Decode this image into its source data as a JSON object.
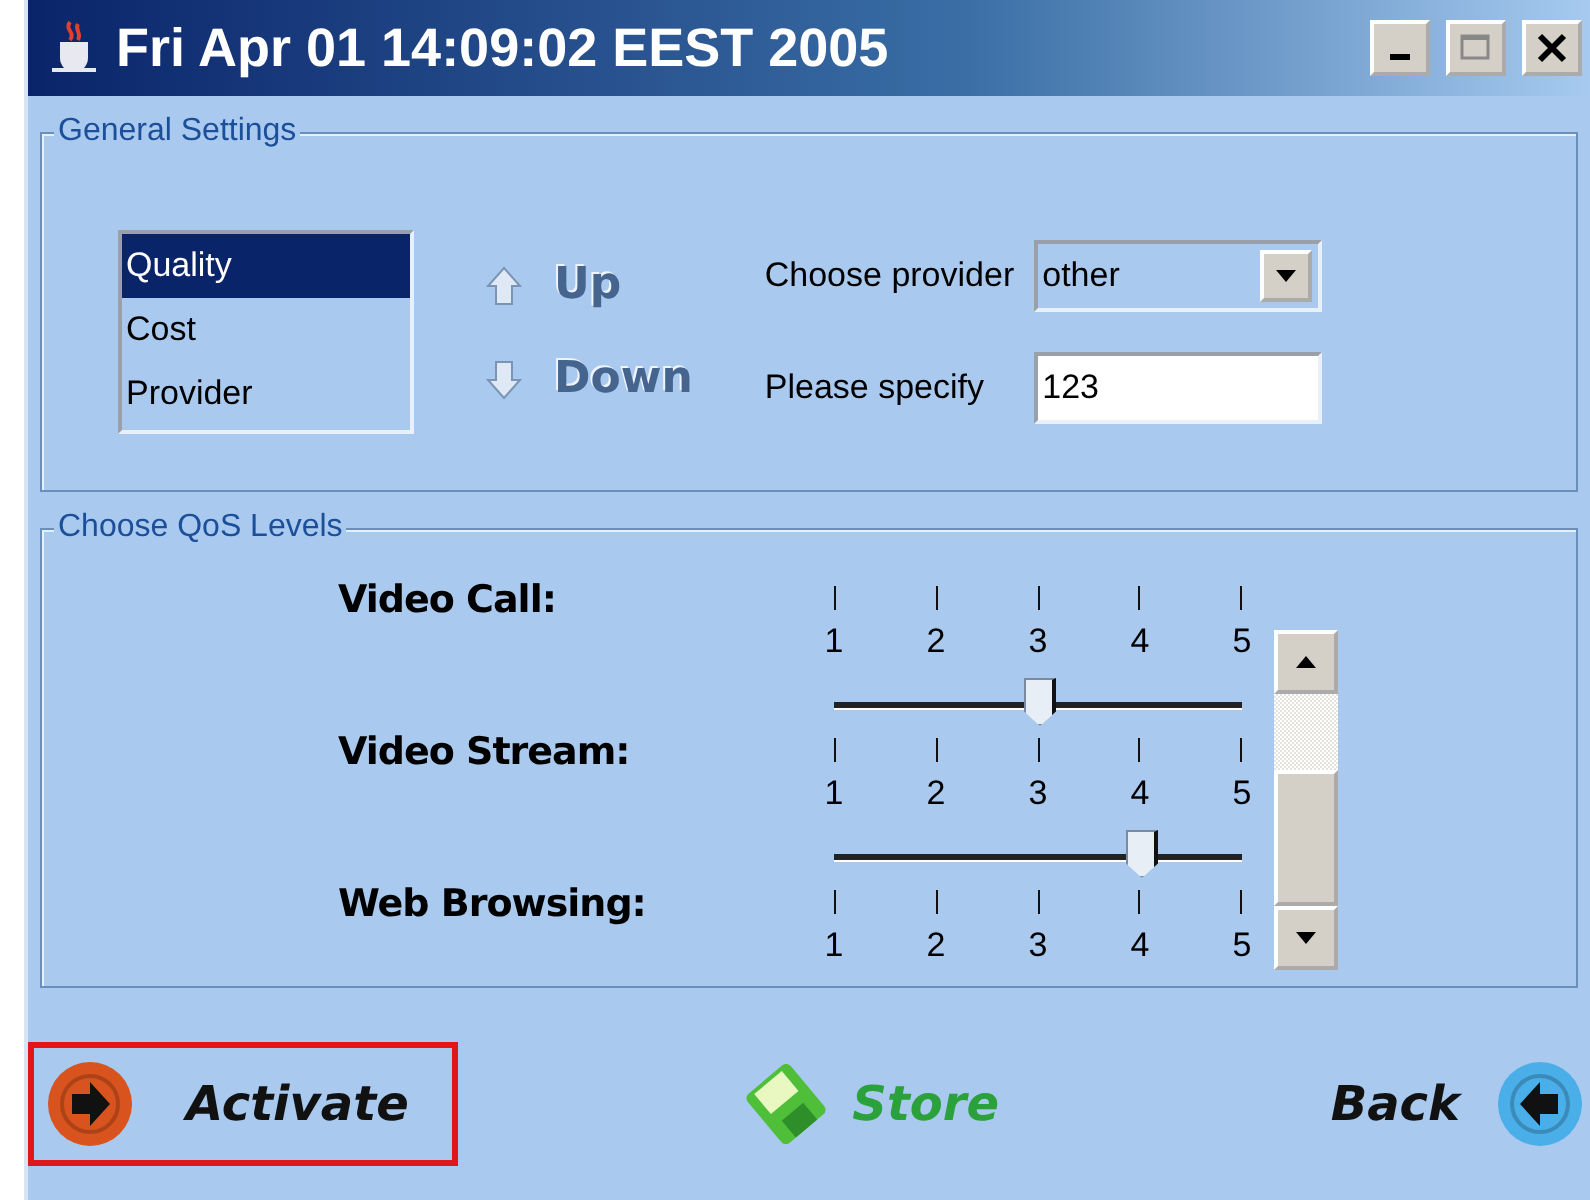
{
  "window": {
    "title": "Fri Apr 01 14:09:02 EEST 2005"
  },
  "general_settings": {
    "title": "General Settings",
    "criteria": [
      {
        "label": "Quality",
        "selected": true
      },
      {
        "label": "Cost",
        "selected": false
      },
      {
        "label": "Provider",
        "selected": false
      }
    ],
    "up_button": {
      "label": "Up",
      "disabled": true
    },
    "down_button": {
      "label": "Down",
      "disabled": true
    },
    "provider": {
      "label": "Choose provider",
      "value": "other"
    },
    "specify": {
      "label": "Please specify",
      "value": "123"
    }
  },
  "qos": {
    "title": "Choose QoS Levels",
    "sliders": [
      {
        "label": "Video Call:",
        "ticks": [
          "1",
          "2",
          "3",
          "4",
          "5"
        ]
      },
      {
        "label": "Video Stream:",
        "level": 0.5,
        "ticks": [
          "1",
          "2",
          "3",
          "4",
          "5"
        ]
      },
      {
        "label": "Web Browsing:",
        "level": 0.75,
        "ticks": [
          "1",
          "2",
          "3",
          "4",
          "5"
        ]
      }
    ]
  },
  "actions": [
    {
      "label": "Activate",
      "kind": "activate",
      "focused": true
    },
    {
      "label": "Store",
      "kind": "store",
      "focused": false
    },
    {
      "label": "Back",
      "kind": "back",
      "focused": false
    }
  ]
}
